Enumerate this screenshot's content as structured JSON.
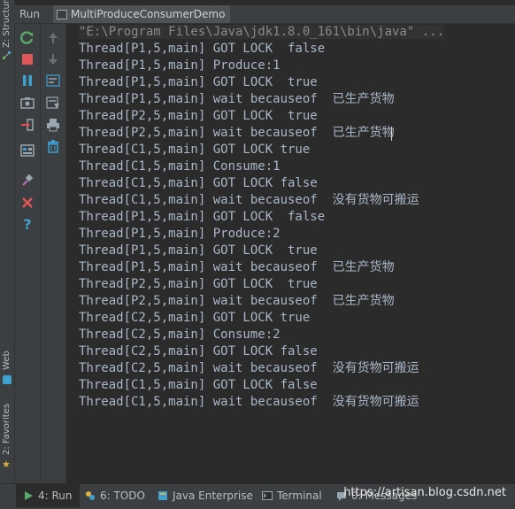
{
  "side_tabs": [
    "Z: Structure",
    "Web",
    "2: Favorites"
  ],
  "run_header": {
    "label": "Run",
    "tab_title": "MultiProduceConsumerDemo"
  },
  "console": {
    "command": "\"E:\\Program Files\\Java\\jdk1.8.0_161\\bin\\java\" ...",
    "lines": [
      "Thread[P1,5,main] GOT LOCK  false",
      "Thread[P1,5,main] Produce:1",
      "Thread[P1,5,main] GOT LOCK  true",
      "Thread[P1,5,main] wait becauseof  已生产货物",
      "Thread[P2,5,main] GOT LOCK  true",
      "Thread[P2,5,main] wait becauseof  已生产货物",
      "Thread[C1,5,main] GOT LOCK true",
      "Thread[C1,5,main] Consume:1",
      "Thread[C1,5,main] GOT LOCK false",
      "Thread[C1,5,main] wait becauseof  没有货物可搬运",
      "Thread[P1,5,main] GOT LOCK  false",
      "Thread[P1,5,main] Produce:2",
      "Thread[P1,5,main] GOT LOCK  true",
      "Thread[P1,5,main] wait becauseof  已生产货物",
      "Thread[P2,5,main] GOT LOCK  true",
      "Thread[P2,5,main] wait becauseof  已生产货物",
      "Thread[C2,5,main] GOT LOCK true",
      "Thread[C2,5,main] Consume:2",
      "Thread[C2,5,main] GOT LOCK false",
      "Thread[C2,5,main] wait becauseof  没有货物可搬运",
      "Thread[C1,5,main] GOT LOCK false",
      "Thread[C1,5,main] wait becauseof  没有货物可搬运"
    ]
  },
  "bottom_tabs": [
    {
      "label": "4: Run",
      "icon": "run-icon"
    },
    {
      "label": "6: TODO",
      "icon": "todo-icon"
    },
    {
      "label": "Java Enterprise",
      "icon": "java-enterprise-icon"
    },
    {
      "label": "Terminal",
      "icon": "terminal-icon"
    },
    {
      "label": "0: Messages",
      "icon": "messages-icon"
    }
  ],
  "watermark": "https://artisan.blog.csdn.net",
  "colors": {
    "background": "#2b2b2b",
    "panel": "#3c3f41",
    "text": "#a9b7c6",
    "command": "#8a8a8a"
  }
}
